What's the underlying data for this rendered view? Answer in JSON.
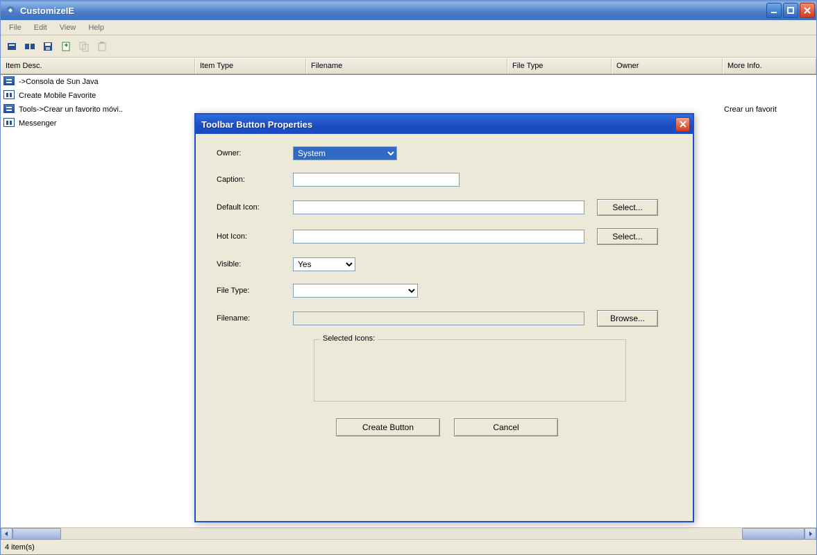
{
  "window": {
    "title": "CustomizeIE"
  },
  "menu": {
    "file": "File",
    "edit": "Edit",
    "view": "View",
    "help": "Help"
  },
  "columns": {
    "item_desc": "Item Desc.",
    "item_type": "Item Type",
    "filename": "Filename",
    "file_type": "File Type",
    "owner": "Owner",
    "more_info": "More Info."
  },
  "rows": [
    {
      "icon": "blue",
      "desc": "->Consola de Sun Java",
      "more": ""
    },
    {
      "icon": "box",
      "desc": "Create Mobile Favorite",
      "more": ""
    },
    {
      "icon": "blue",
      "desc": "Tools->Crear un favorito móvi..",
      "more": "Crear un favorit"
    },
    {
      "icon": "box",
      "desc": "Messenger",
      "more": ""
    }
  ],
  "status": {
    "text": "4 item(s)"
  },
  "dialog": {
    "title": "Toolbar Button Properties",
    "labels": {
      "owner": "Owner:",
      "caption": "Caption:",
      "default_icon": "Default Icon:",
      "hot_icon": "Hot Icon:",
      "visible": "Visible:",
      "file_type": "File Type:",
      "filename": "Filename:",
      "selected_icons": "Selected Icons:"
    },
    "values": {
      "owner": "System",
      "caption": "",
      "default_icon": "",
      "hot_icon": "",
      "visible": "Yes",
      "file_type": "",
      "filename": ""
    },
    "buttons": {
      "select": "Select...",
      "browse": "Browse...",
      "create": "Create Button",
      "cancel": "Cancel"
    }
  }
}
